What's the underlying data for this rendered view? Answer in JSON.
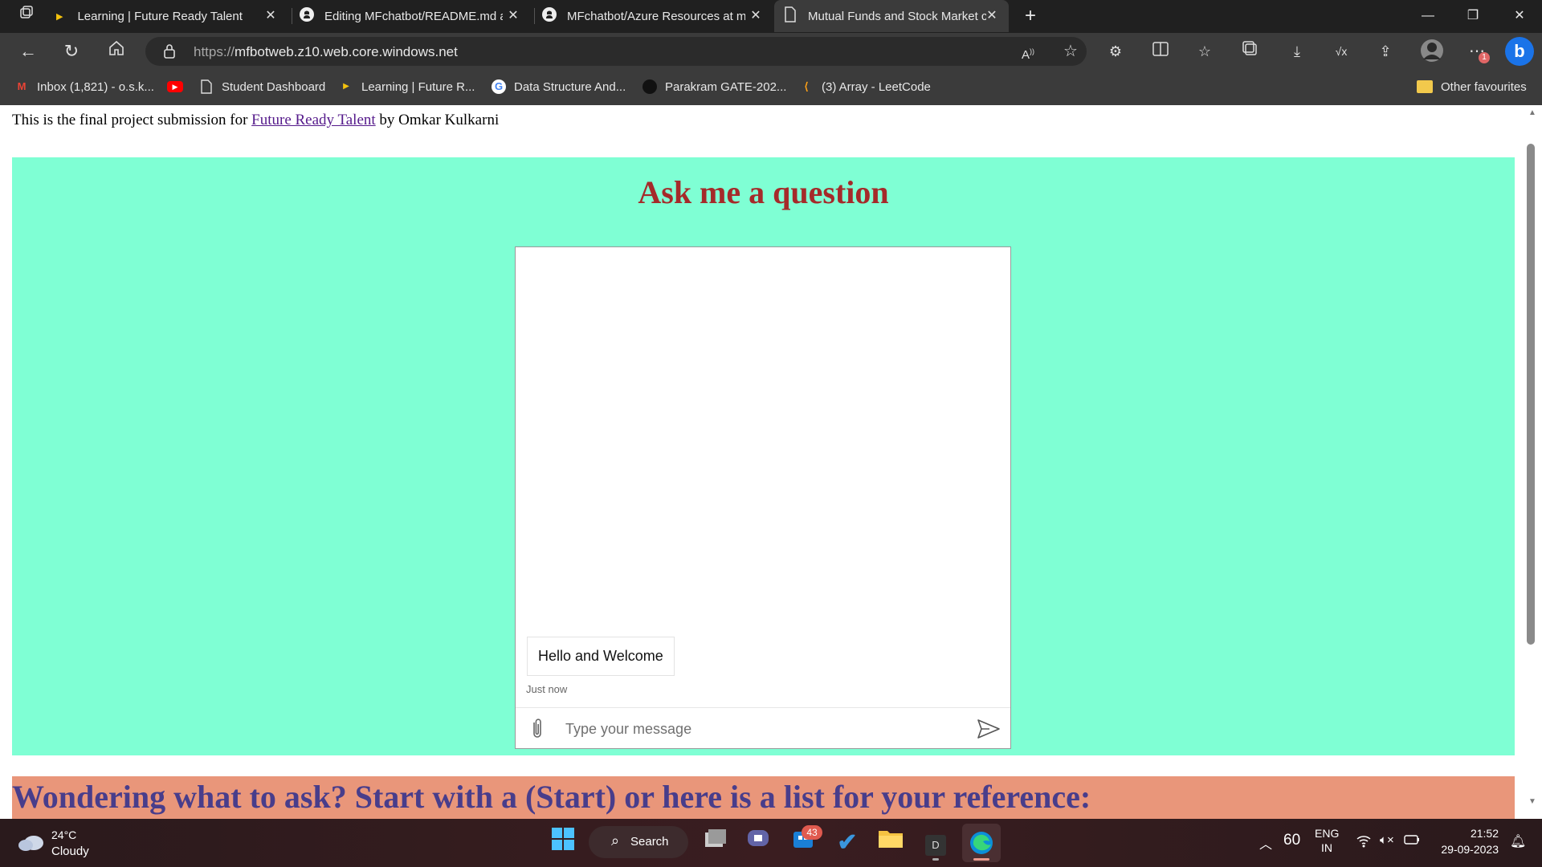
{
  "browser": {
    "tabs": [
      {
        "title": "Learning | Future Ready Talent",
        "icon": "play-favicon",
        "active": false
      },
      {
        "title": "Editing MFchatbot/README.md a",
        "icon": "github-icon",
        "active": false
      },
      {
        "title": "MFchatbot/Azure Resources at m",
        "icon": "github-icon",
        "active": false
      },
      {
        "title": "Mutual Funds and Stock Market c",
        "icon": "page-icon",
        "active": true
      }
    ],
    "url_protocol": "https://",
    "url_host": "mfbotweb.z10.web.core.windows.net",
    "bookmarks": [
      {
        "label": "Inbox (1,821) - o.s.k...",
        "icon": "gmail-icon"
      },
      {
        "label": "",
        "icon": "youtube-icon"
      },
      {
        "label": "Student Dashboard",
        "icon": "page-icon"
      },
      {
        "label": "Learning | Future R...",
        "icon": "play-favicon"
      },
      {
        "label": "Data Structure And...",
        "icon": "google-icon"
      },
      {
        "label": "Parakram GATE-202...",
        "icon": "avatar-icon"
      },
      {
        "label": "(3) Array - LeetCode",
        "icon": "leetcode-icon"
      }
    ],
    "other_favourites": "Other favourites",
    "notification_badge": "1"
  },
  "page": {
    "intro_prefix": "This is the final project submission for ",
    "intro_link": "Future Ready Talent",
    "intro_suffix": " by Omkar Kulkarni",
    "ask_title": "Ask me a question",
    "chat": {
      "message": "Hello and Welcome",
      "timestamp": "Just now",
      "placeholder": "Type your message"
    },
    "wonder_text": "Wondering what to ask? Start with a (Start) or here is a list for your reference:"
  },
  "taskbar": {
    "weather_temp": "24°C",
    "weather_desc": "Cloudy",
    "search_label": "Search",
    "store_badge": "43",
    "battery": "60",
    "lang_line1": "ENG",
    "lang_line2": "IN",
    "time": "21:52",
    "date": "29-09-2023"
  },
  "colors": {
    "chat_bg": "#7fffd4",
    "title_color": "#a52a2a",
    "wonder_bg": "#e9967a",
    "wonder_color": "#483d8b"
  }
}
